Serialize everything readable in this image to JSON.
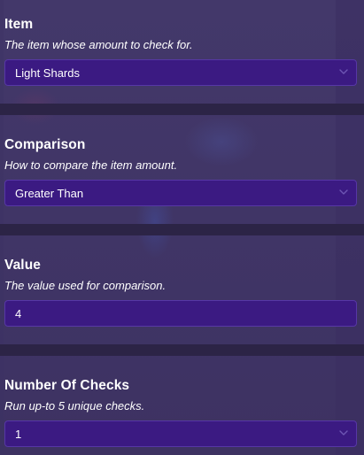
{
  "sections": [
    {
      "title": "Item",
      "description": "The item whose amount to check for.",
      "value": "Light Shards",
      "control": "dropdown",
      "icon": "chevron-down-icon"
    },
    {
      "title": "Comparison",
      "description": "How to compare the item amount.",
      "value": "Greater Than",
      "control": "dropdown",
      "icon": "chevron-down-icon"
    },
    {
      "title": "Value",
      "description": "The value used for comparison.",
      "value": "4",
      "control": "text-input"
    },
    {
      "title": "Number Of Checks",
      "description": "Run up-to 5 unique checks.",
      "value": "1",
      "control": "dropdown",
      "icon": "chevron-down-icon"
    }
  ],
  "colors": {
    "panel_background": "#3f3565",
    "divider": "#2c2446",
    "field_background": "#3b1a82",
    "field_border": "#5737a6",
    "text": "#ffffff",
    "chevron": "#6d56b3"
  }
}
